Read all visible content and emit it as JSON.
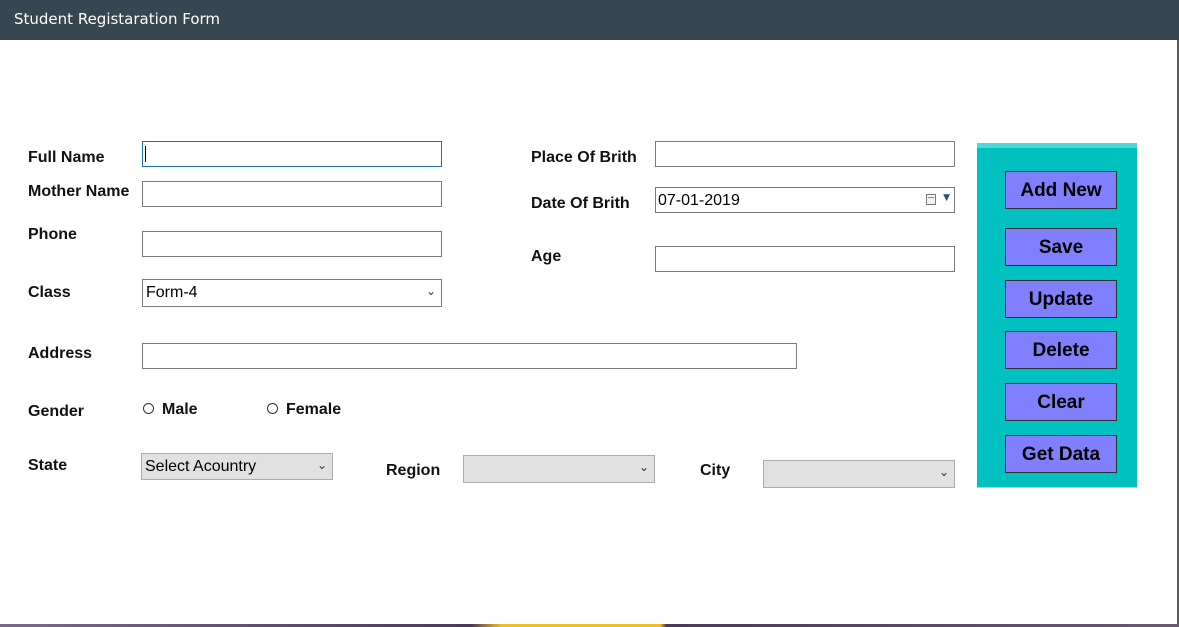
{
  "window": {
    "title": "Student Registaration Form"
  },
  "form": {
    "full_name": {
      "label": "Full Name",
      "value": ""
    },
    "mother_name": {
      "label": "Mother Name",
      "value": ""
    },
    "phone": {
      "label": "Phone",
      "value": ""
    },
    "class": {
      "label": "Class",
      "selected": "Form-4"
    },
    "address": {
      "label": "Address",
      "value": ""
    },
    "gender": {
      "label": "Gender",
      "options": [
        "Male",
        "Female"
      ],
      "selected": null
    },
    "state": {
      "label": "State",
      "selected": "Select Acountry"
    },
    "region": {
      "label": "Region",
      "selected": ""
    },
    "city": {
      "label": "City",
      "selected": ""
    },
    "place_of_birth": {
      "label": "Place Of Brith",
      "value": ""
    },
    "date_of_birth": {
      "label": "Date Of Brith",
      "value": "07-01-2019"
    },
    "age": {
      "label": "Age",
      "value": ""
    }
  },
  "actions": {
    "add_new": "Add New",
    "save": "Save",
    "update": "Update",
    "delete": "Delete",
    "clear": "Clear",
    "get_data": "Get Data"
  },
  "colors": {
    "titlebar": "#37474f",
    "panel": "#00c0c0",
    "button": "#8080ff"
  }
}
